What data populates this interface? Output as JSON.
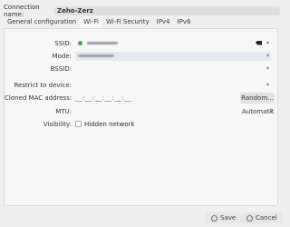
{
  "connection": {
    "label": "Connection name:",
    "value": "Zeho-Zerz"
  },
  "tabs": [
    {
      "label": "General configuration"
    },
    {
      "label": "Wi-Fi"
    },
    {
      "label": "Wi-Fi Security"
    },
    {
      "label": "IPv4"
    },
    {
      "label": "IPv6"
    }
  ],
  "active_tab": "Wi-Fi",
  "wifi": {
    "ssid_label": "SSID:",
    "mode_label": "Mode:",
    "bssid_label": "BSSID:",
    "restrict_label": "Restrict to device:",
    "mac_label": "Cloned MAC address:",
    "mac_placeholder": "__:__:__:__:__:__",
    "random_label": "Random...",
    "mtu_label": "MTU:",
    "mtu_value": "Automatic",
    "visibility_label": "Visibility:",
    "hidden_label": "Hidden network"
  },
  "footer": {
    "save_label": "Save",
    "cancel_label": "Cancel"
  },
  "icons": [
    "network-dot-icon",
    "backspace-icon",
    "chevron-down-icon",
    "stepper-icon",
    "save-icon",
    "cancel-icon"
  ],
  "colors": {
    "accent_field": "#e4e9f1",
    "status_green": "#3aa55a"
  }
}
